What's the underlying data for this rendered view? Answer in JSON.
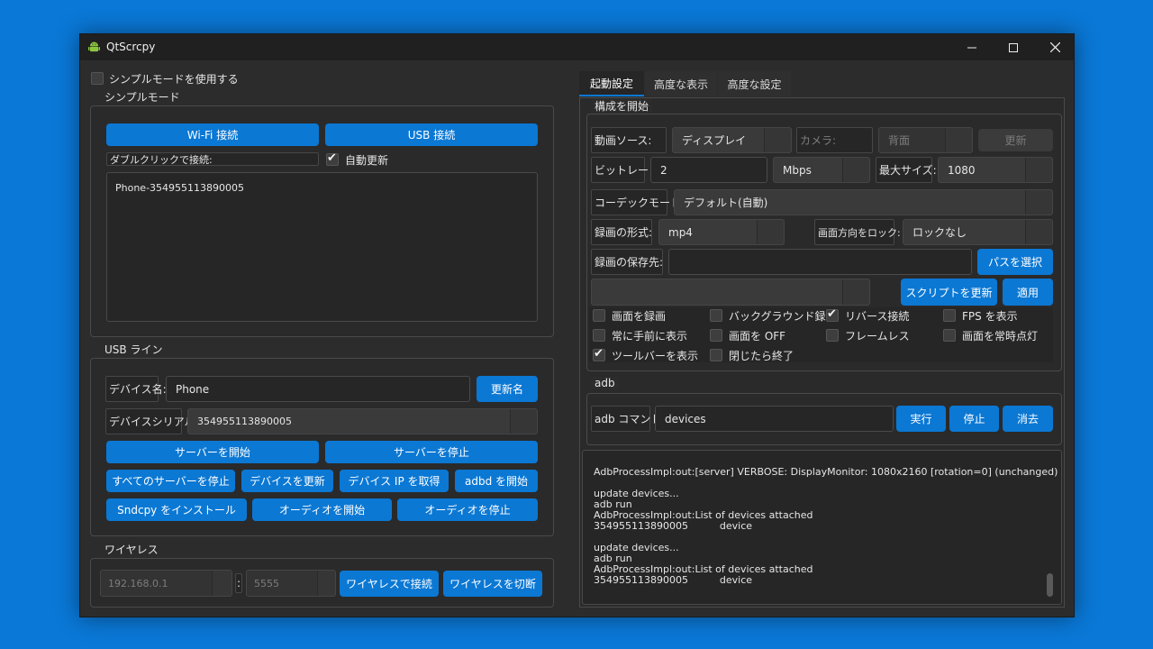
{
  "window": {
    "title": "QtScrcpy"
  },
  "left": {
    "simple_mode_checkbox": "シンプルモードを使用する",
    "simple_group": {
      "title": "シンプルモード",
      "wifi_button": "Wi-Fi 接続",
      "usb_button": "USB 接続",
      "dblclick_label": "ダブルクリックで接続:",
      "auto_update": "自動更新",
      "devices": [
        "Phone-354955113890005"
      ]
    },
    "usb_group": {
      "title": "USB ライン",
      "device_name_label": "デバイス名:",
      "device_name_value": "Phone",
      "rename_button": "更新名",
      "serial_label": "デバイスシリアル:",
      "serial_value": "354955113890005",
      "start_server": "サーバーを開始",
      "stop_server": "サーバーを停止",
      "stop_all": "すべてのサーバーを停止",
      "refresh_devices": "デバイスを更新",
      "get_ip": "デバイス IP を取得",
      "start_adbd": "adbd を開始",
      "install_sndcpy": "Sndcpy をインストール",
      "start_audio": "オーディオを開始",
      "stop_audio": "オーディオを停止"
    },
    "wireless_group": {
      "title": "ワイヤレス",
      "ip": "192.168.0.1",
      "separator": ":",
      "port": "5555",
      "connect": "ワイヤレスで接続",
      "disconnect": "ワイヤレスを切断"
    }
  },
  "right": {
    "tabs": [
      "起動設定",
      "高度な表示",
      "高度な設定"
    ],
    "config_group": {
      "title": "構成を開始",
      "video_source_label": "動画ソース:",
      "video_source_value": "ディスプレイ",
      "camera_label": "カメラ:",
      "camera_value": "背面",
      "refresh": "更新",
      "bitrate_label": "ビットレート:",
      "bitrate_value": "2",
      "bitrate_unit": "Mbps",
      "maxsize_label": "最大サイズ:",
      "maxsize_value": "1080",
      "codec_label": "コーデックモード:",
      "codec_value": "デフォルト(自動)",
      "record_format_label": "録画の形式:",
      "record_format_value": "mp4",
      "lock_label": "画面方向をロック:",
      "lock_value": "ロックなし",
      "save_path_label": "録画の保存先:",
      "select_path": "パスを選択",
      "update_script": "スクリプトを更新",
      "apply": "適用",
      "options": [
        {
          "label": "画面を録画",
          "checked": false
        },
        {
          "label": "バックグラウンド録画",
          "checked": false
        },
        {
          "label": "リバース接続",
          "checked": true
        },
        {
          "label": "FPS を表示",
          "checked": false
        },
        {
          "label": "常に手前に表示",
          "checked": false
        },
        {
          "label": "画面を OFF",
          "checked": false
        },
        {
          "label": "フレームレス",
          "checked": false
        },
        {
          "label": "画面を常時点灯",
          "checked": false
        },
        {
          "label": "ツールバーを表示",
          "checked": true
        },
        {
          "label": "閉じたら終了",
          "checked": false
        }
      ]
    },
    "adb_group": {
      "title": "adb",
      "cmd_label": "adb コマンド:",
      "cmd_value": "devices",
      "run": "実行",
      "stop": "停止",
      "clear": "消去"
    },
    "log_lines": [
      "AdbProcessImpl:out:[server] VERBOSE: DisplayMonitor: 1080x2160 [rotation=0] (unchanged)",
      "update devices...",
      "adb run",
      "AdbProcessImpl:out:List of devices attached",
      "354955113890005\t\tdevice",
      "update devices...",
      "adb run",
      "AdbProcessImpl:out:List of devices attached",
      "354955113890005\t\tdevice"
    ]
  }
}
